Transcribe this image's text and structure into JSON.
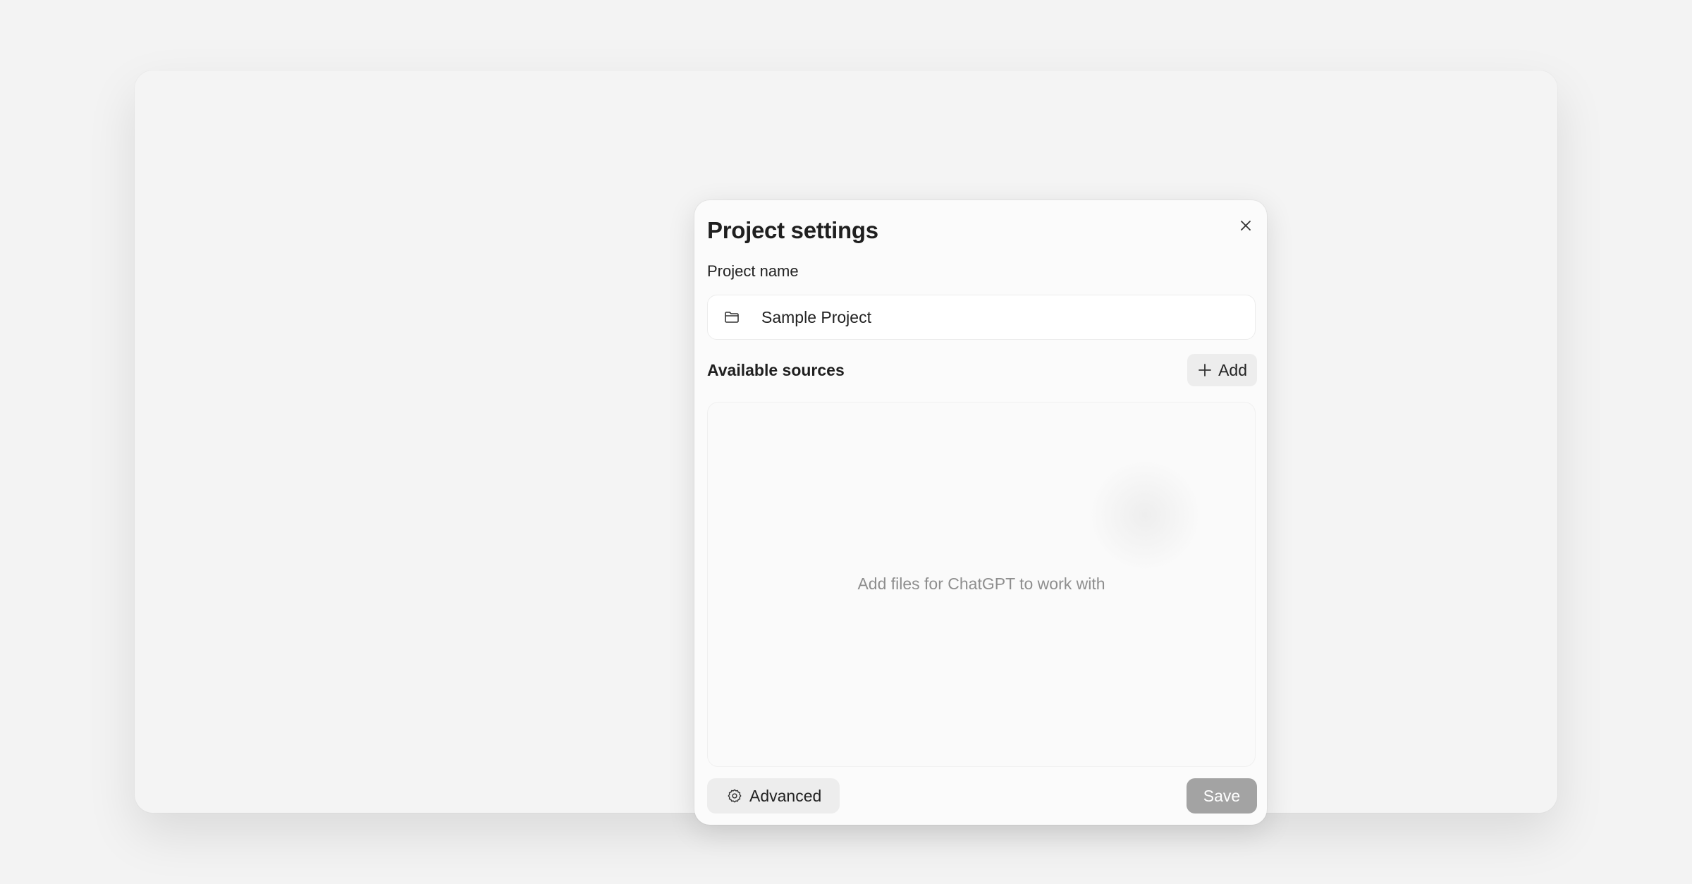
{
  "dialog": {
    "title": "Project settings",
    "project_name_label": "Project name",
    "project_name_value": "Sample Project",
    "sources_header": "Available sources",
    "add_label": "Add",
    "empty_state": "Add files for ChatGPT to work with",
    "advanced_label": "Advanced",
    "save_label": "Save"
  },
  "icons": {
    "close": "close-icon",
    "folder": "folder-icon",
    "plus": "plus-icon",
    "settings": "gear-icon"
  },
  "colors": {
    "save_button": "#a3a3a3",
    "secondary_button": "#ededed",
    "empty_text": "#8e8e8e"
  }
}
